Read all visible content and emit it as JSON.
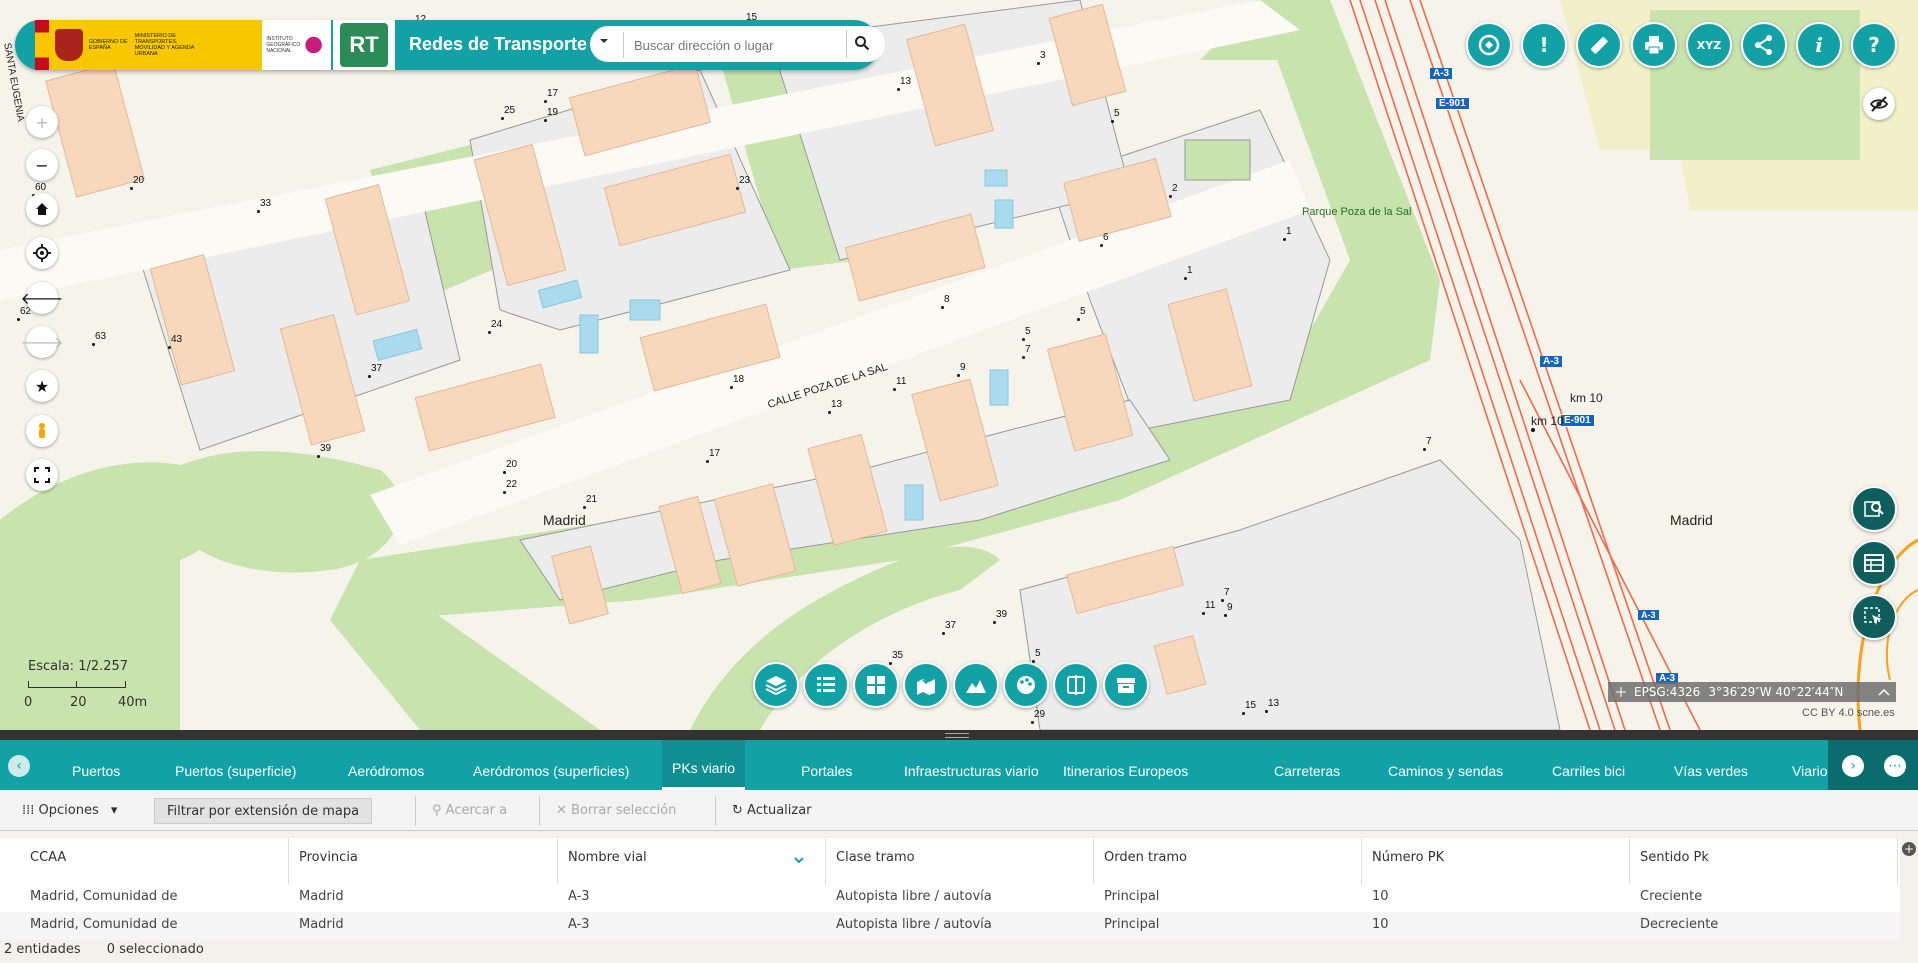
{
  "header": {
    "gov_text": "GOBIERNO DE ESPAÑA",
    "ministry_text": "MINISTERIO DE TRANSPORTES, MOVILIDAD Y AGENDA URBANA",
    "ign_text": "INSTITUTO GEOGRÁFICO NACIONAL",
    "app_logo_text": "RT",
    "app_title": "Redes de Transporte",
    "search_placeholder": "Buscar dirección o lugar"
  },
  "colors": {
    "accent": "#12a2a6",
    "dark_accent": "#0f5e5d",
    "road_highlight": "#ef6a4c",
    "park": "#c8e3ad",
    "building": "#f8d8bd"
  },
  "top_tools": [
    "measure-area-icon",
    "incident-icon",
    "ruler-icon",
    "print-icon",
    "xyz-coordinates-icon",
    "share-icon",
    "info-icon",
    "help-icon"
  ],
  "top_tools_text": {
    "incident": "!",
    "xyz": "XYZ",
    "info": "i",
    "help": "?"
  },
  "map": {
    "street_labels": [
      "CALLE POZA DE LA SAL",
      "Parque Poza de la Sal",
      "SANTA EUGENIA"
    ],
    "place_labels": [
      "Madrid",
      "Madrid"
    ],
    "road_shields": [
      "A-3",
      "E-901",
      "A-3",
      "E-901",
      "A-3",
      "A-3"
    ],
    "km_labels": [
      "km 10",
      "km 10"
    ],
    "house_numbers": [
      "12",
      "15",
      "17",
      "19",
      "25",
      "13",
      "3",
      "5",
      "20",
      "33",
      "23",
      "2",
      "6",
      "1",
      "1",
      "62",
      "63",
      "43",
      "24",
      "8",
      "5",
      "7",
      "5",
      "37",
      "18",
      "13",
      "11",
      "9",
      "39",
      "20",
      "22",
      "21",
      "17",
      "7",
      "37",
      "39",
      "35",
      "5",
      "11",
      "9",
      "7",
      "15",
      "13",
      "29",
      "60"
    ],
    "scale_label": "Escala: 1/2.257",
    "scale_ticks": [
      "0",
      "20",
      "40m"
    ],
    "crs": "EPSG:4326",
    "coordinates": "3°36′29″W 40°22′44″N",
    "attribution": "CC BY 4.0 scne.es"
  },
  "panel": {
    "tabs": [
      "Puertos",
      "Puertos (superficie)",
      "Aeródromos",
      "Aeródromos (superficies)",
      "PKs viario",
      "Portales",
      "Infraestructuras viario",
      "Itinerarios Europeos",
      "Carreteras",
      "Caminos y sendas",
      "Carriles bici",
      "Vías verdes",
      "Viario"
    ],
    "active_tab": "PKs viario",
    "toolbar": {
      "options": "Opciones",
      "filter": "Filtrar por extensión de mapa",
      "zoom_to": "Acercar a",
      "clear_selection": "Borrar selección",
      "refresh": "Actualizar"
    },
    "columns": [
      "CCAA",
      "Provincia",
      "Nombre vial",
      "Clase tramo",
      "Orden tramo",
      "Número PK",
      "Sentido Pk"
    ],
    "rows": [
      [
        "Madrid, Comunidad de",
        "Madrid",
        "A-3",
        "Autopista libre / autovía",
        "Principal",
        "10",
        "Creciente"
      ],
      [
        "Madrid, Comunidad de",
        "Madrid",
        "A-3",
        "Autopista libre / autovía",
        "Principal",
        "10",
        "Decreciente"
      ]
    ],
    "status_count": "2 entidades",
    "status_selected": "0 seleccionado"
  }
}
